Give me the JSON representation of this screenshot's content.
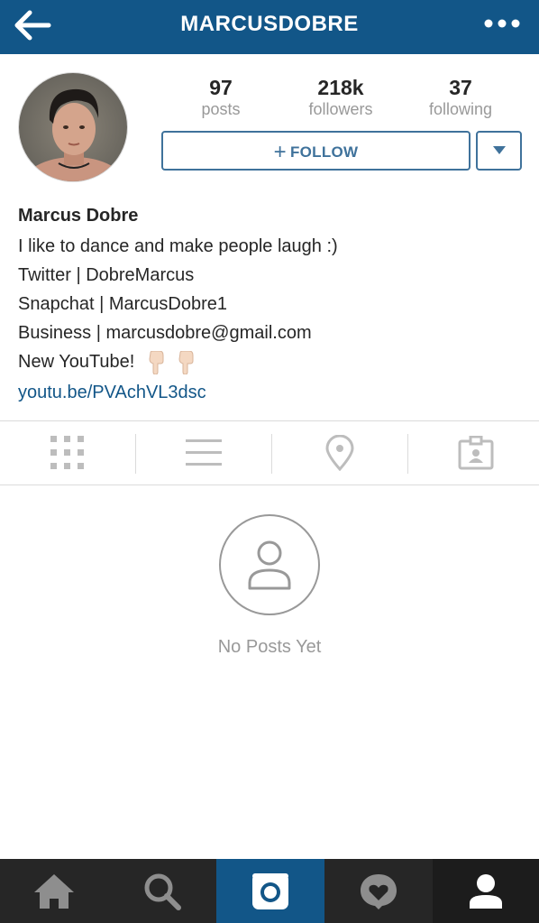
{
  "header": {
    "title": "MARCUSDOBRE",
    "back_icon": "back-arrow-icon",
    "more_icon": "more-dots-icon"
  },
  "profile": {
    "stats": {
      "posts": {
        "count": "97",
        "label": "posts"
      },
      "followers": {
        "count": "218k",
        "label": "followers"
      },
      "following": {
        "count": "37",
        "label": "following"
      }
    },
    "follow_button": {
      "plus": "+",
      "label": "FOLLOW"
    },
    "bio": {
      "name": "Marcus Dobre",
      "lines": [
        "I like to dance and make people laugh :)",
        "Twitter | DobreMarcus",
        "Snapchat | MarcusDobre1",
        "Business | marcusdobre@gmail.com",
        "New YouTube!"
      ],
      "link": "youtu.be/PVAchVL3dsc"
    }
  },
  "tabs": [
    "grid-icon",
    "list-icon",
    "location-pin-icon",
    "tagged-icon"
  ],
  "empty_state": {
    "message": "No Posts Yet"
  },
  "bottom_nav": [
    "home-icon",
    "search-icon",
    "camera-icon",
    "activity-icon",
    "profile-icon"
  ],
  "colors": {
    "brand": "#125688",
    "accent": "#3f729b",
    "muted": "#999999"
  }
}
